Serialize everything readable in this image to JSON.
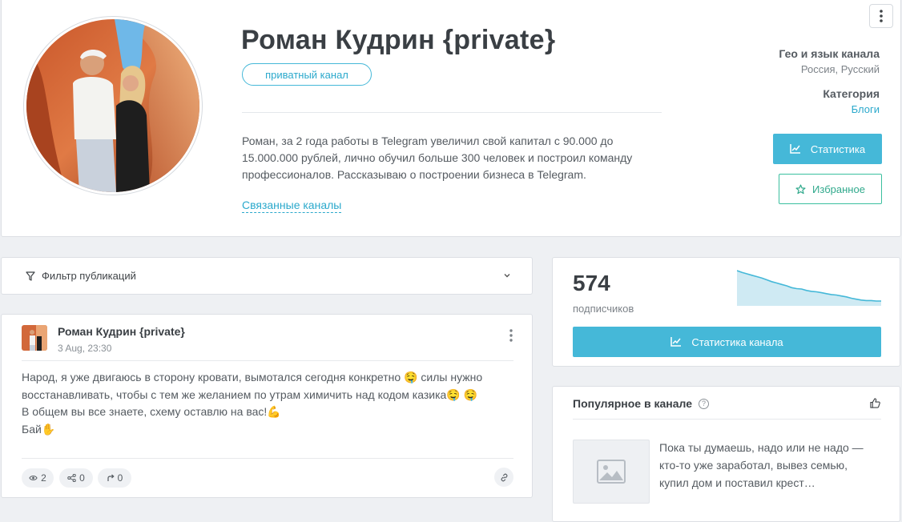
{
  "header": {
    "title": "Роман Кудрин {private}",
    "badge": "приватный канал",
    "description": "Роман, за 2 года работы в Telegram увеличил свой капитал с 90.000 до 15.000.000 рублей, лично обучил больше 300 человек и построил команду профессионалов. Рассказываю о построении бизнеса в Telegram.",
    "related_link": "Связанные каналы",
    "more_icon": "⋮",
    "geo_label": "Гео и язык канала",
    "geo_value": "Россия, Русский",
    "category_label": "Категория",
    "category_value": "Блоги",
    "stats_button": "Статистика",
    "favorite_button": "Избранное"
  },
  "filter": {
    "label": "Фильтр публикаций"
  },
  "post": {
    "author": "Роман Кудрин {private}",
    "date": "3 Aug, 23:30",
    "lines": [
      "Народ, я уже двигаюсь в сторону кровати, вымотался сегодня конкретно 🤤  силы нужно",
      "восстанавливать,  чтобы с тем же желанием по утрам химичить над кодом казика🤤 🤤",
      "В общем вы все знаете,  схему оставлю на вас!💪",
      "Бай✋"
    ],
    "views": "2",
    "shares": "0",
    "forwards": "0"
  },
  "subscribers": {
    "count": "574",
    "label": "подписчиков",
    "button": "Статистика канала",
    "trend": [
      100,
      96,
      93,
      90,
      87,
      84,
      80,
      76,
      73,
      70,
      67,
      63,
      61,
      60,
      57,
      55,
      54,
      52,
      50,
      48,
      47,
      45,
      43,
      40,
      38,
      36,
      35,
      35,
      34,
      34
    ]
  },
  "popular": {
    "title": "Популярное в канале",
    "help_icon": "?",
    "text": "Пока ты думаешь, надо или не надо — кто-то уже заработал, вывез семью, купил дом и поставил крест…"
  },
  "colors": {
    "accent": "#45b8d8",
    "favorite": "#3bbf9f"
  }
}
